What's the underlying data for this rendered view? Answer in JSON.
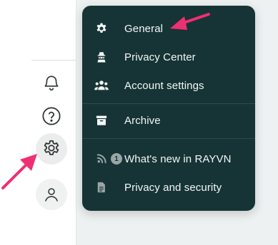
{
  "sidebar": {
    "items": [
      {
        "name": "notifications",
        "icon": "bell-icon"
      },
      {
        "name": "help",
        "icon": "question-circle-icon"
      },
      {
        "name": "settings",
        "icon": "gear-icon",
        "active": true
      },
      {
        "name": "profile",
        "icon": "user-icon"
      }
    ]
  },
  "menu": {
    "items": [
      {
        "label": "General",
        "icon": "gear-icon"
      },
      {
        "label": "Privacy Center",
        "icon": "privacy-agent-icon"
      },
      {
        "label": "Account settings",
        "icon": "people-icon"
      },
      {
        "label": "Archive",
        "icon": "archive-box-icon"
      },
      {
        "label": "What's new in RAYVN",
        "icon": "rss-icon",
        "badge": "1"
      },
      {
        "label": "Privacy and security",
        "icon": "document-icon"
      }
    ]
  },
  "colors": {
    "menu_bg": "#163435",
    "menu_text": "#f4f7f7",
    "arrow": "#ef2f73",
    "icon_stroke": "#2c3334"
  }
}
